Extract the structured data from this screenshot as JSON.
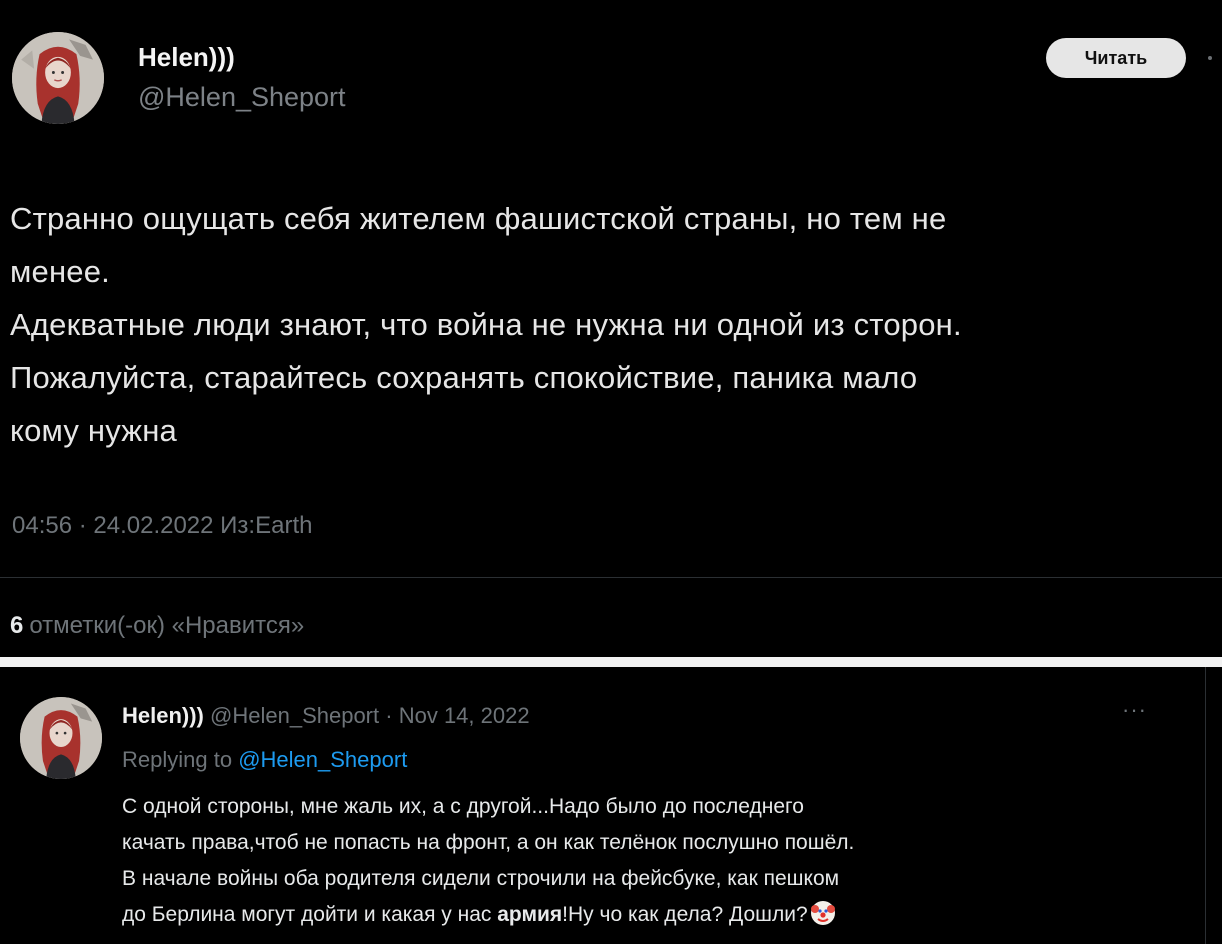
{
  "tweet1": {
    "display_name": "Helen)))",
    "handle": "@Helen_Sheport",
    "read_button": "Читать",
    "body_lines": [
      "Странно ощущать себя жителем фашистской страны, но тем не",
      "менее.",
      "Адекватные люди знают, что война не нужна ни одной из сторон.",
      "Пожалуйста, старайтесь сохранять спокойствие, паника мало",
      "кому нужна"
    ],
    "meta": "04:56 · 24.02.2022 Из:Earth",
    "likes_count": "6",
    "likes_text": "отметки(-ок) «Нравится»"
  },
  "tweet2": {
    "display_name": "Helen)))",
    "handle": "@Helen_Sheport",
    "separator": "·",
    "date": "Nov 14, 2022",
    "more_icon": "···",
    "replying_prefix": "Replying to",
    "replying_handle": "@Helen_Sheport",
    "body_lines": [
      "С одной стороны, мне жаль их, а с другой...Надо было до последнего",
      "качать права,чтоб не попасть на фронт, а он как телёнок послушно пошёл.",
      "В начале войны оба родителя сидели строчили на фейсбуке, как пешком"
    ],
    "last_line_before": "до Берлина могут дойти и какая у нас ",
    "last_line_bold": "армия",
    "last_line_after": "!Ну чо как дела? Дошли?",
    "emoji": "clown-face-icon"
  },
  "colors": {
    "background": "#000000",
    "text": "#e7e9ea",
    "muted": "#6e7479",
    "link": "#1d9bf0",
    "button_bg": "#e6e6e6"
  }
}
